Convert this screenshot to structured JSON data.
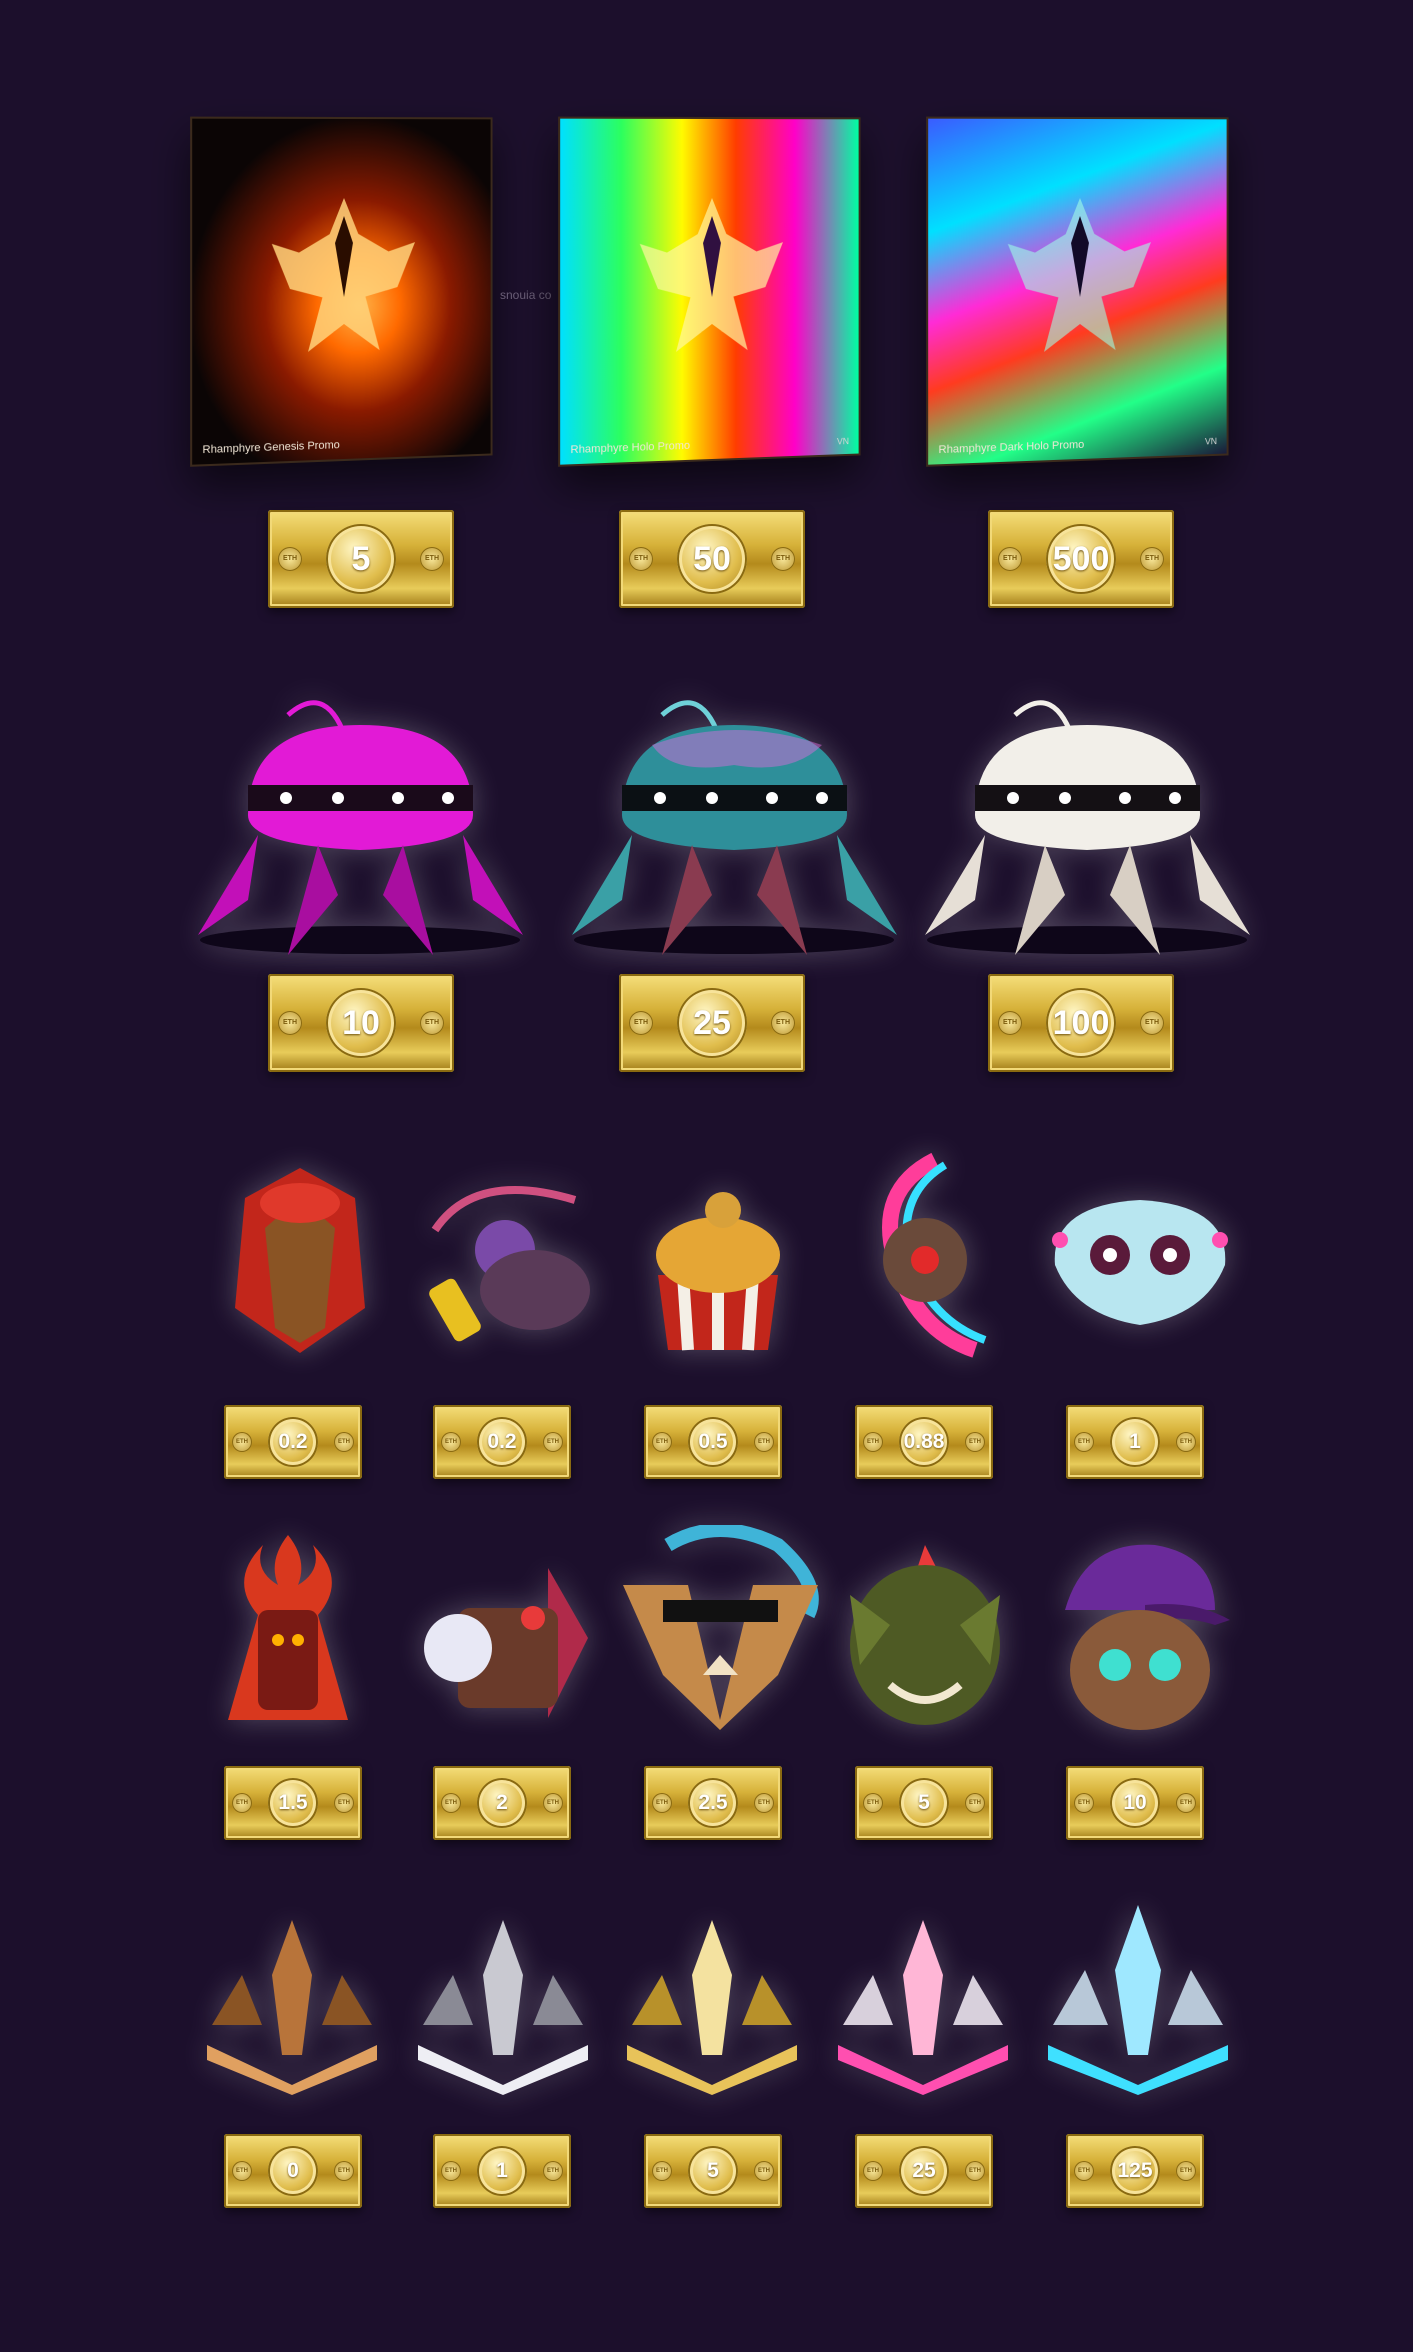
{
  "promo_cards": [
    {
      "caption": "Rhamphyre Genesis Promo",
      "corner": "",
      "price": "5"
    },
    {
      "caption": "Rhamphyre Holo Promo",
      "corner": "VN",
      "price": "50"
    },
    {
      "caption": "Rhamphyre Dark Holo Promo",
      "corner": "VN",
      "price": "500"
    }
  ],
  "card_watermark": "snouia co",
  "currency_label": "ETH",
  "crawlers": [
    {
      "finish": "magenta",
      "color": "#e21ad6",
      "price": "10"
    },
    {
      "finish": "holo",
      "color": "#2e8f9a",
      "price": "25"
    },
    {
      "finish": "white",
      "color": "#f2efe9",
      "price": "100"
    }
  ],
  "creatures_row1": [
    {
      "icon": "red-bird-creature-icon",
      "price": "0.2"
    },
    {
      "icon": "purple-rhino-creature-icon",
      "price": "0.2"
    },
    {
      "icon": "chicken-bucket-creature-icon",
      "price": "0.5"
    },
    {
      "icon": "rainbow-serpent-creature-icon",
      "price": "0.88"
    },
    {
      "icon": "blue-skull-creature-icon",
      "price": "1"
    }
  ],
  "creatures_row2": [
    {
      "icon": "fire-golem-creature-icon",
      "price": "1.5"
    },
    {
      "icon": "mech-creature-icon",
      "price": "2"
    },
    {
      "icon": "cool-cat-creature-icon",
      "price": "2.5"
    },
    {
      "icon": "green-goblin-creature-icon",
      "price": "5"
    },
    {
      "icon": "lv-cap-creature-icon",
      "price": "10"
    }
  ],
  "tiers": [
    {
      "icon": "bronze-tier-icon",
      "color": "#b8743a",
      "price": "0"
    },
    {
      "icon": "silver-tier-icon",
      "color": "#c9c9d1",
      "price": "1"
    },
    {
      "icon": "gold-tier-icon",
      "color": "#e8c35a",
      "price": "5"
    },
    {
      "icon": "pink-crystal-tier-icon",
      "color": "#ff4fb0",
      "price": "25"
    },
    {
      "icon": "cyan-crystal-tier-icon",
      "color": "#3fe0ff",
      "price": "125"
    }
  ]
}
